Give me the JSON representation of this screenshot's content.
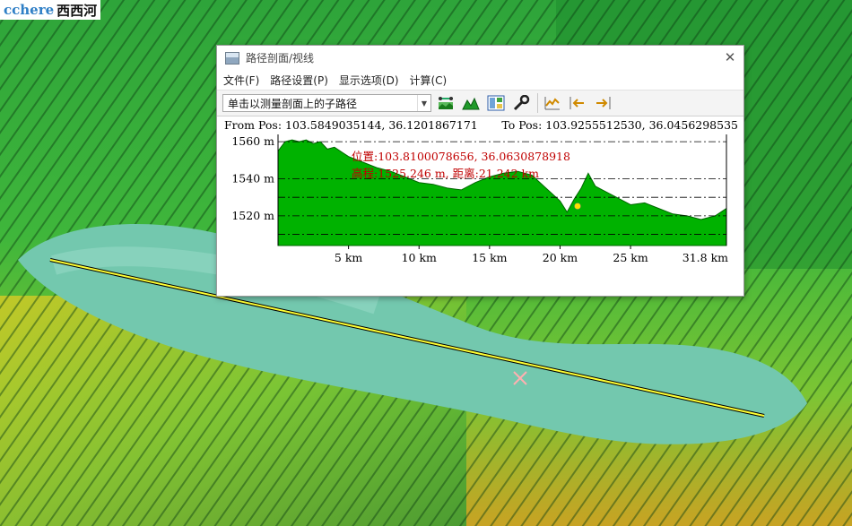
{
  "logo": {
    "brand": "cchere",
    "name": "西西河"
  },
  "window": {
    "title": "路径剖面/视线",
    "close_glyph": "✕"
  },
  "menu": [
    "文件(F)",
    "路径设置(P)",
    "显示选项(D)",
    "计算(C)"
  ],
  "toolbar": {
    "combo_value": "单击以测量剖面上的子路径",
    "icons": [
      "profile-settings-icon",
      "terrain-icon",
      "layout-icon",
      "wrench-icon",
      "profile-line-icon",
      "left-arrow-icon",
      "right-arrow-icon"
    ]
  },
  "profile": {
    "from_pos": "From Pos: 103.5849035144, 36.1201867171",
    "to_pos": "To Pos: 103.9255512530, 36.0456298535",
    "tooltip_line1": "位置:103.8100078656, 36.0630878918",
    "tooltip_line2": "高程:1525.246 m, 距离:21.242 km"
  },
  "colors": {
    "fill": "#00b200",
    "tooltip": "#c00000",
    "path": "#ffff33",
    "marker": "#ffe000"
  },
  "chart_data": {
    "type": "area",
    "x_ticks": [
      5,
      10,
      15,
      20,
      25
    ],
    "x_tick_labels": [
      "5 km",
      "10 km",
      "15 km",
      "20 km",
      "25 km",
      "31.8 km"
    ],
    "x_range": [
      0,
      31.8
    ],
    "y_ticks": [
      1520,
      1540,
      1560
    ],
    "y_tick_labels": [
      "1520 m",
      "1540 m",
      "1560 m"
    ],
    "y_range": [
      1504,
      1562
    ],
    "grid": true,
    "marker": {
      "x": 21.242,
      "y": 1525.246
    },
    "x": [
      0,
      0.5,
      1,
      1.5,
      2,
      2.5,
      3,
      3.5,
      4,
      5,
      6,
      7,
      8,
      9,
      10,
      11,
      12,
      13,
      14,
      15,
      16,
      17,
      18,
      19,
      20,
      20.5,
      21,
      21.5,
      22,
      22.5,
      23,
      24,
      25,
      26,
      27,
      28,
      29,
      30,
      31,
      31.8
    ],
    "y": [
      1555,
      1560,
      1561,
      1560,
      1561,
      1559,
      1560,
      1556,
      1557,
      1552,
      1549,
      1546,
      1544,
      1541,
      1538,
      1537,
      1535,
      1534,
      1538,
      1541,
      1543,
      1544,
      1542,
      1535,
      1528,
      1522,
      1529,
      1535,
      1543,
      1536,
      1534,
      1530,
      1526,
      1527,
      1524,
      1521,
      1520,
      1518,
      1520,
      1524
    ]
  }
}
